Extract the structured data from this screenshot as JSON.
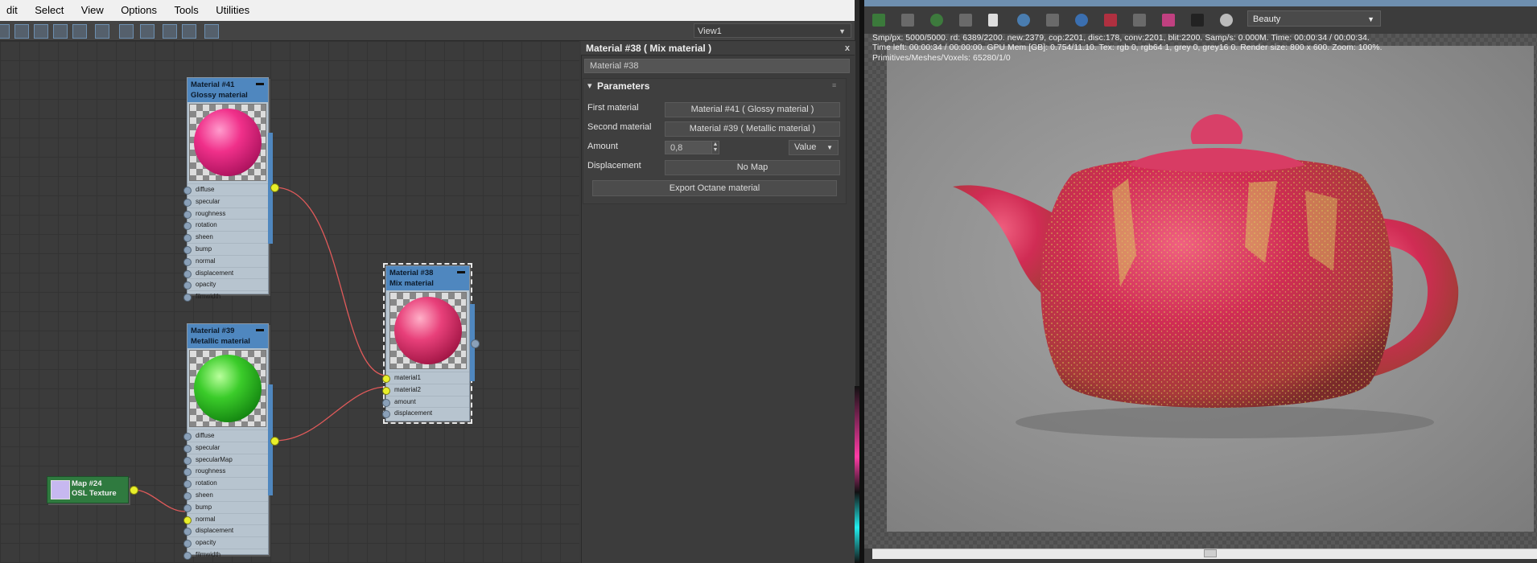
{
  "menu": [
    "dit",
    "Select",
    "View",
    "Options",
    "Tools",
    "Utilities"
  ],
  "view_selector": "View1",
  "nodes": {
    "glossy": {
      "id": "Material #41",
      "type": "Glossy material",
      "ports": [
        "diffuse",
        "specular",
        "roughness",
        "rotation",
        "sheen",
        "bump",
        "normal",
        "displacement",
        "opacity",
        "filmwidth"
      ]
    },
    "metallic": {
      "id": "Material #39",
      "type": "Metallic material",
      "ports": [
        "diffuse",
        "specular",
        "specularMap",
        "roughness",
        "rotation",
        "sheen",
        "bump",
        "normal",
        "displacement",
        "opacity",
        "filmwidth"
      ]
    },
    "mix": {
      "id": "Material #38",
      "type": "Mix material",
      "ports": [
        "material1",
        "material2",
        "amount",
        "displacement"
      ]
    },
    "map": {
      "id": "Map #24",
      "type": "OSL Texture"
    }
  },
  "panel": {
    "title": "Material #38  ( Mix material )",
    "close": "x",
    "name_value": "Material #38",
    "section": "Parameters",
    "first_label": "First material",
    "first_value": "Material #41  ( Glossy material )",
    "second_label": "Second material",
    "second_value": "Material #39  ( Metallic material )",
    "amount_label": "Amount",
    "amount_value": "0,8",
    "amount_mode": "Value",
    "displacement_label": "Displacement",
    "displacement_value": "No Map",
    "export_button": "Export Octane material"
  },
  "render": {
    "pass": "Beauty",
    "stats": [
      "Smp/px: 5000/5000.   rd: 6389/2200.   new:2379, cop:2201, disc:178, conv:2201, blit:2200.   Samp/s: 0.000M.   Time: 00:00:34 / 00:00:34.",
      "Time left: 00:00:34 / 00:00:00.   GPU Mem [GB]: 0.754/11.10.   Tex: rgb 0, rgb64 1, grey 0, grey16 0.   Render size: 800 x 600.   Zoom: 100%.",
      "Primitives/Meshes/Voxels: 65280/1/0"
    ]
  },
  "colors": {
    "node_header": "#4f87bf",
    "port_active": "#e8ef2a",
    "wire": "#e05a5a",
    "map_node": "#2f7a3f"
  }
}
